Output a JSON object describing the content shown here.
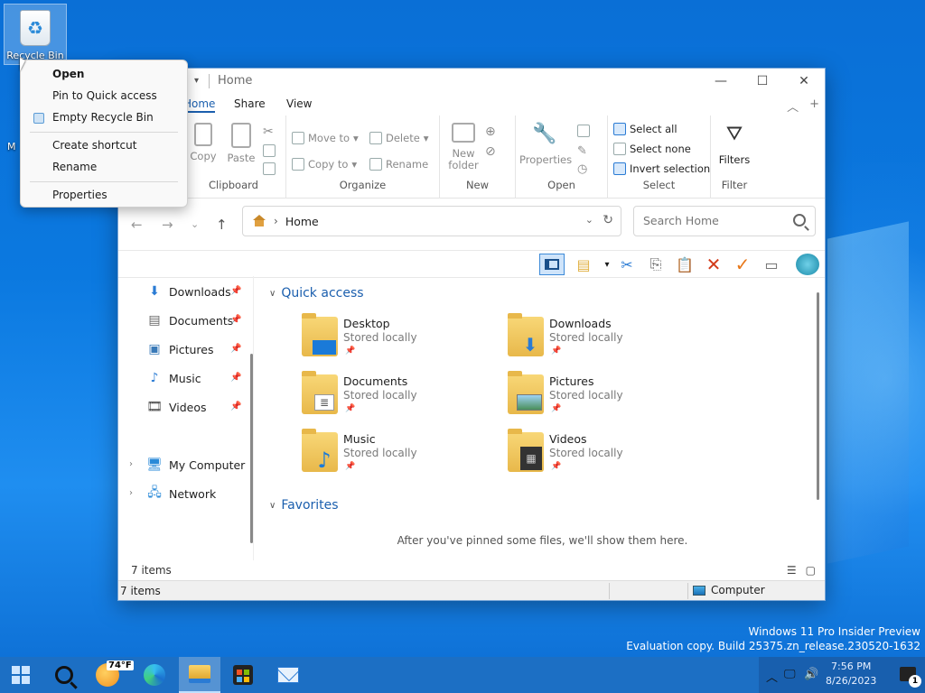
{
  "desktop": {
    "icons": [
      {
        "label": "Recycle Bin"
      },
      {
        "label": "My Computer"
      }
    ]
  },
  "context_menu": {
    "items": [
      {
        "label": "Open",
        "bold": true
      },
      {
        "label": "Pin to Quick access"
      },
      {
        "label": "Empty Recycle Bin"
      },
      {
        "label": "Create shortcut"
      },
      {
        "label": "Rename"
      },
      {
        "label": "Properties"
      }
    ]
  },
  "window": {
    "title": "Home",
    "tabs": [
      "Home",
      "Share",
      "View"
    ],
    "ribbon": {
      "clipboard": {
        "label": "Clipboard",
        "copy": "Copy",
        "paste": "Paste"
      },
      "organize": {
        "label": "Organize",
        "move_to": "Move to",
        "copy_to": "Copy to",
        "delete": "Delete",
        "rename": "Rename"
      },
      "new": {
        "label": "New",
        "new_folder": "New folder"
      },
      "open": {
        "label": "Open",
        "properties": "Properties"
      },
      "select": {
        "label": "Select",
        "select_all": "Select all",
        "select_none": "Select none",
        "invert_selection": "Invert selection"
      },
      "filter": {
        "label": "Filter",
        "filters": "Filters"
      }
    },
    "address": {
      "path": "Home"
    },
    "search": {
      "placeholder": "Search Home"
    },
    "sidebar": {
      "items": [
        {
          "label": "Downloads",
          "icon": "download-arrow-icon",
          "pinned": true
        },
        {
          "label": "Documents",
          "icon": "document-icon",
          "pinned": true
        },
        {
          "label": "Pictures",
          "icon": "picture-icon",
          "pinned": true
        },
        {
          "label": "Music",
          "icon": "music-note-icon",
          "pinned": true
        },
        {
          "label": "Videos",
          "icon": "film-icon",
          "pinned": true
        },
        {
          "label": "My Computer",
          "icon": "computer-icon",
          "pinned": false
        },
        {
          "label": "Network",
          "icon": "network-icon",
          "pinned": false
        }
      ]
    },
    "quick_access": {
      "heading": "Quick access",
      "items": [
        {
          "name": "Desktop",
          "sub": "Stored locally",
          "icon": "desktop-icon"
        },
        {
          "name": "Downloads",
          "sub": "Stored locally",
          "icon": "download-arrow-icon"
        },
        {
          "name": "Documents",
          "sub": "Stored locally",
          "icon": "document-icon"
        },
        {
          "name": "Pictures",
          "sub": "Stored locally",
          "icon": "picture-icon"
        },
        {
          "name": "Music",
          "sub": "Stored locally",
          "icon": "music-note-icon"
        },
        {
          "name": "Videos",
          "sub": "Stored locally",
          "icon": "film-icon"
        }
      ]
    },
    "favorites": {
      "heading": "Favorites",
      "empty_message": "After you've pinned some files, we'll show them here."
    },
    "status": {
      "count": "7 items",
      "count2": "7 items",
      "location": "Computer"
    }
  },
  "watermark": {
    "line1": "Windows 11 Pro Insider Preview",
    "line2": "Evaluation copy. Build 25375.zn_release.230520-1632"
  },
  "taskbar": {
    "weather_temp": "74°F",
    "time": "7:56 PM",
    "date": "8/26/2023",
    "notification_count": "1"
  },
  "colors": {
    "accent": "#1b5fae",
    "taskbar": "#1c6fc4"
  }
}
